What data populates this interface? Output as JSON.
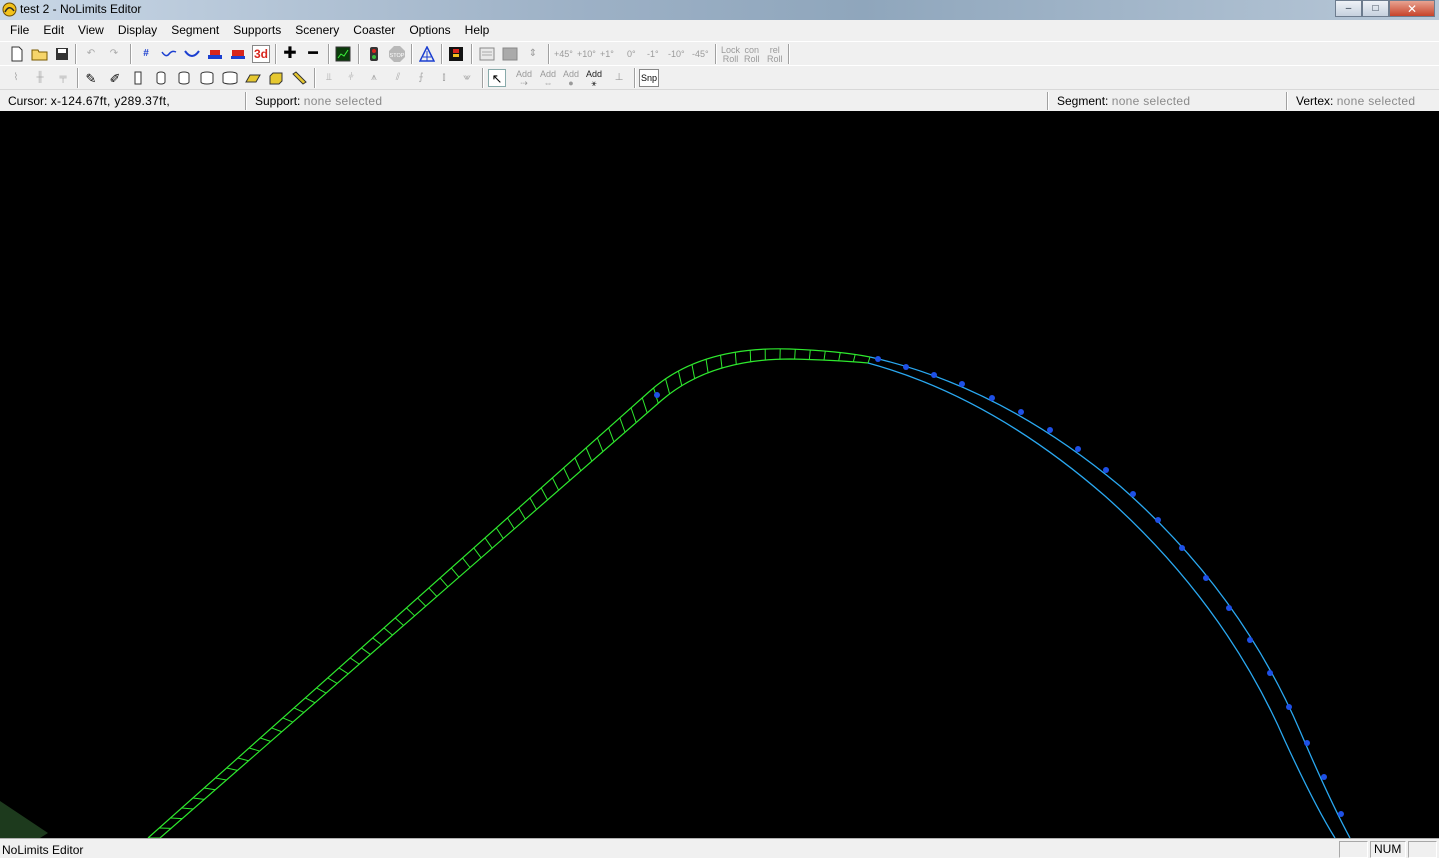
{
  "window": {
    "title": "test 2 - NoLimits Editor",
    "controls": {
      "minimize": "–",
      "maximize": "□",
      "close": "✕"
    }
  },
  "menu": [
    "File",
    "Edit",
    "View",
    "Display",
    "Segment",
    "Supports",
    "Scenery",
    "Coaster",
    "Options",
    "Help"
  ],
  "toolbar": {
    "icons_row1": [
      "new-file-icon",
      "open-folder-icon",
      "save-icon",
      "undo-icon",
      "redo-icon",
      "grid-icon",
      "track-wave-icon",
      "track-dip-icon",
      "station-icon",
      "train-icon",
      "3d-view-icon",
      "insert-icon",
      "remove-icon",
      "stats-icon",
      "traffic-light-icon",
      "stop-icon",
      "pylon-icon",
      "brake-icon",
      "view-box-icon",
      "fill-box-icon",
      "align-icon"
    ],
    "label_3d": "3d",
    "label_stop": "STOP",
    "angle_labels": [
      "+45°",
      "+10°",
      "+1°",
      "0°",
      "-1°",
      "-10°",
      "-45°"
    ],
    "roll_labels": [
      [
        "Lock",
        "Roll"
      ],
      [
        "con",
        "Roll"
      ],
      [
        "rel",
        "Roll"
      ]
    ],
    "icons_row2": [
      "support-a-icon",
      "support-b-icon",
      "support-c-icon",
      "pencil-icon",
      "multi-pencil-icon",
      "pillar-icon",
      "cyl-1-icon",
      "cyl-2-icon",
      "cyl-3-icon",
      "cyl-4-icon",
      "plank-icon",
      "block-icon",
      "beam-icon",
      "tower-1-icon",
      "tower-2-icon",
      "tower-3-icon",
      "tower-4-icon",
      "tower-5-icon",
      "tower-6-icon",
      "select-arrow-icon"
    ],
    "add_labels": [
      "Add",
      "Add",
      "Add",
      "Add"
    ],
    "snap_label": "Snp"
  },
  "status": {
    "cursor_label": "Cursor:",
    "cursor_value": "x-124.67ft, y289.37ft,",
    "support_label": "Support:",
    "support_value": "none selected",
    "segment_label": "Segment:",
    "segment_value": "none selected",
    "vertex_label": "Vertex:",
    "vertex_value": "none selected"
  },
  "viewport": {
    "background": "#000000",
    "track_color_green": "#2ee82e",
    "track_color_cyan": "#2aa8f0",
    "vertex_color": "#1e50e6"
  },
  "bottom": {
    "app_name": "NoLimits Editor",
    "num_indicator": "NUM"
  }
}
